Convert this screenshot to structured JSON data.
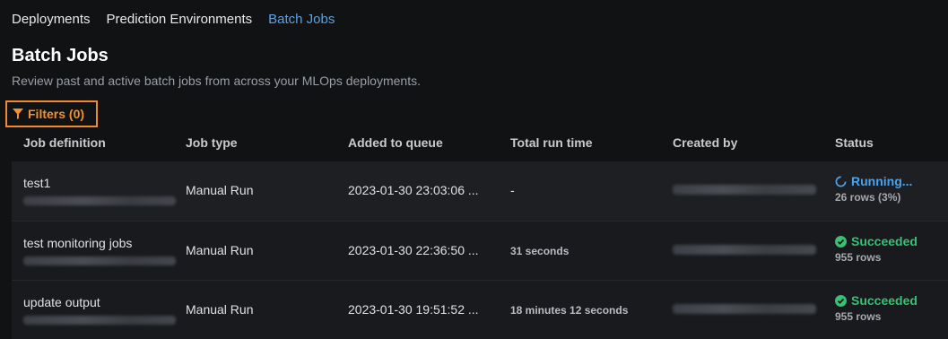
{
  "nav": {
    "tabs": [
      {
        "label": "Deployments",
        "active": false
      },
      {
        "label": "Prediction Environments",
        "active": false
      },
      {
        "label": "Batch Jobs",
        "active": true
      }
    ]
  },
  "header": {
    "title": "Batch Jobs",
    "subtitle": "Review past and active batch jobs from across your MLOps deployments."
  },
  "filters": {
    "label": "Filters (0)",
    "icon": "filter-icon",
    "color": "#f5902e"
  },
  "table": {
    "columns": [
      "Job definition",
      "Job type",
      "Added to queue",
      "Total run time",
      "Created by",
      "Status"
    ],
    "rows": [
      {
        "job": "test1",
        "type": "Manual Run",
        "added": "2023-01-30 23:03:06 ...",
        "runtime": "-",
        "status": "Running...",
        "status_kind": "running",
        "rows": "26 rows (3%)"
      },
      {
        "job": "test monitoring jobs",
        "type": "Manual Run",
        "added": "2023-01-30 22:36:50 ...",
        "runtime": "31 seconds",
        "status": "Succeeded",
        "status_kind": "succeeded",
        "rows": "955 rows"
      },
      {
        "job": "update output",
        "type": "Manual Run",
        "added": "2023-01-30 19:51:52 ...",
        "runtime": "18 minutes 12 seconds",
        "status": "Succeeded",
        "status_kind": "succeeded",
        "rows": "955 rows"
      }
    ]
  },
  "colors": {
    "accent_link": "#5aa2e6",
    "running": "#4aa3ec",
    "succeeded": "#38c172",
    "filter_highlight": "#f18a2d"
  }
}
